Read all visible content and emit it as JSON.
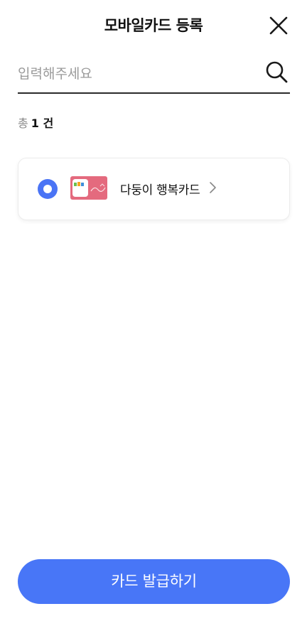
{
  "header": {
    "title": "모바일카드 등록",
    "close_icon": "close-icon"
  },
  "search": {
    "placeholder": "입력해주세요",
    "value": "",
    "icon": "search-icon"
  },
  "summary": {
    "prefix": "총",
    "count": "1 건"
  },
  "cards": [
    {
      "name": "다둥이 행복카드",
      "selected": true,
      "thumbnail_color": "#e46a7e"
    }
  ],
  "footer": {
    "issue_label": "카드 발급하기"
  },
  "colors": {
    "accent": "#4876f7",
    "text": "#111111",
    "muted": "#9a9a9a"
  }
}
